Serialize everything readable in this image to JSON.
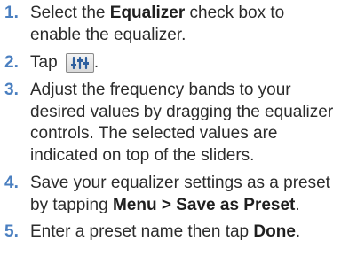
{
  "clipped_heading_fragment": "                  ",
  "steps": [
    {
      "number": "1.",
      "parts": [
        "Select the ",
        "Equalizer",
        " check box to enable the equalizer."
      ]
    },
    {
      "number": "2.",
      "parts": [
        "Tap ",
        "."
      ],
      "icon": "equalizer-settings-icon"
    },
    {
      "number": "3.",
      "text": "Adjust the frequency bands to your desired values by dragging the equalizer controls. The selected values are indicated on top of the sliders."
    },
    {
      "number": "4.",
      "parts": [
        "Save your equalizer settings as a preset by tapping ",
        "Menu > Save as Preset",
        "."
      ]
    },
    {
      "number": "5.",
      "parts": [
        "Enter a preset name then tap ",
        "Done",
        "."
      ]
    }
  ],
  "colors": {
    "step_number": "#4a7fc0",
    "body_text": "#2b2b2b",
    "icon_bars": "#2e5f9e"
  }
}
